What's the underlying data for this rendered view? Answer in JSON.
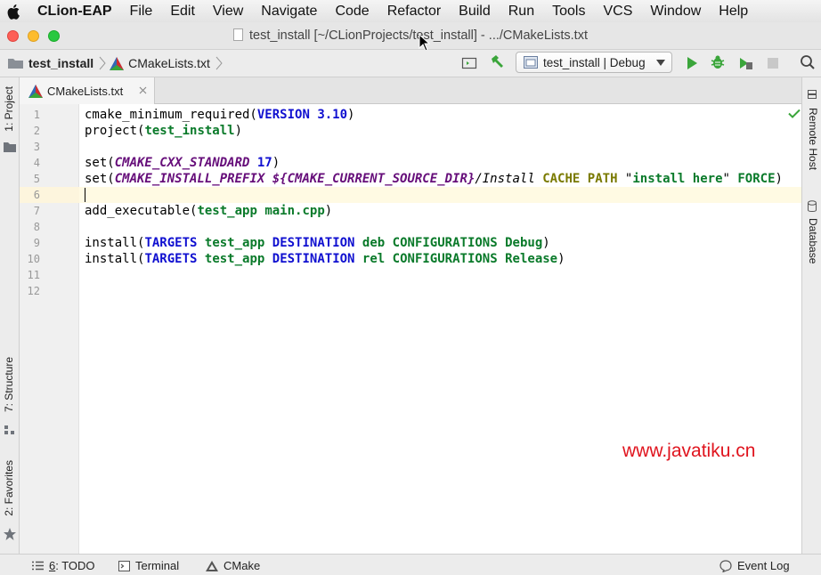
{
  "menubar": {
    "app_name": "CLion-EAP",
    "items": [
      "File",
      "Edit",
      "View",
      "Navigate",
      "Code",
      "Refactor",
      "Build",
      "Run",
      "Tools",
      "VCS",
      "Window",
      "Help"
    ]
  },
  "window": {
    "title": "test_install [~/CLionProjects/test_install] - .../CMakeLists.txt"
  },
  "navbar": {
    "project": "test_install",
    "file": "CMakeLists.txt",
    "run_config": "test_install | Debug"
  },
  "left_tools": {
    "project": "1: Project",
    "structure": "7: Structure",
    "favorites": "2: Favorites"
  },
  "right_tools": {
    "remote_host": "Remote Host",
    "database": "Database"
  },
  "editor": {
    "tab_label": "CMakeLists.txt",
    "current_line": 6,
    "line_numbers": [
      "1",
      "2",
      "3",
      "4",
      "5",
      "6",
      "7",
      "8",
      "9",
      "10",
      "11",
      "12"
    ],
    "lines": [
      "cmake_minimum_required(VERSION 3.10)",
      "project(test_install)",
      "",
      "set(CMAKE_CXX_STANDARD 17)",
      "set(CMAKE_INSTALL_PREFIX ${CMAKE_CURRENT_SOURCE_DIR}/Install CACHE PATH \"install here\" FORCE)",
      "",
      "add_executable(test_app main.cpp)",
      "",
      "install(TARGETS test_app DESTINATION deb CONFIGURATIONS Debug)",
      "install(TARGETS test_app DESTINATION rel CONFIGURATIONS Release)",
      "",
      ""
    ]
  },
  "watermark": "www.javatiku.cn",
  "statusbar": {
    "todo_num": "6",
    "todo_label": ": TODO",
    "terminal": "Terminal",
    "cmake": "CMake",
    "event_log": "Event Log"
  },
  "colors": {
    "keyword_blue": "#1010d0",
    "keyword_green": "#0a7a2a",
    "variable_purple": "#660e7a",
    "cache_olive": "#7a7a00",
    "run_green": "#3aa53a",
    "current_line": "#fffae3"
  },
  "icons": [
    "apple-icon",
    "folder-icon",
    "cmake-triangle-icon",
    "hammer-icon",
    "run-icon",
    "debug-icon",
    "profile-icon",
    "stop-icon",
    "search-icon",
    "check-icon"
  ]
}
